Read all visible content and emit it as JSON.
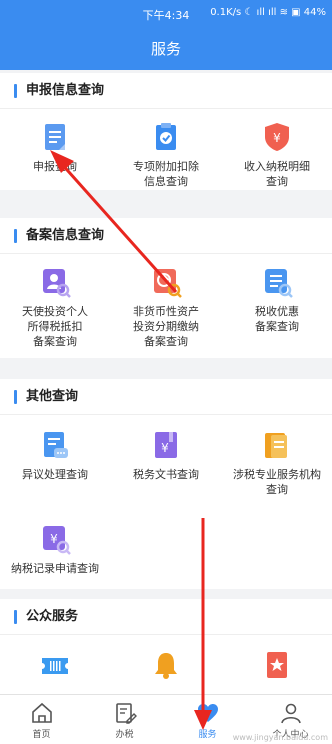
{
  "status_bar": {
    "time": "下午4:34",
    "indicators": "0.1K/s ☾ ıll ıll ≋ ▣ 44%"
  },
  "header": {
    "title": "服务"
  },
  "sections": [
    {
      "title": "申报信息查询",
      "items": [
        {
          "label": "申报查询",
          "icon": "document-icon",
          "color": "#5b9af0"
        },
        {
          "label": "专项附加扣除\n信息查询",
          "icon": "check-clipboard-icon",
          "color": "#3a8cf0"
        },
        {
          "label": "收入纳税明细\n查询",
          "icon": "yuan-shield-icon",
          "color": "#f06050"
        }
      ]
    },
    {
      "title": "备案信息查询",
      "items": [
        {
          "label": "天使投资个人\n所得税抵扣\n备案查询",
          "icon": "person-search-icon",
          "color": "#8a6ae6"
        },
        {
          "label": "非货币性资产\n投资分期缴纳\n备案查询",
          "icon": "chart-search-icon",
          "color": "#f06a5a"
        },
        {
          "label": "税收优惠\n备案查询",
          "icon": "list-search-icon",
          "color": "#4a96f0"
        }
      ]
    },
    {
      "title": "其他查询",
      "items": [
        {
          "label": "异议处理查询",
          "icon": "chat-doc-icon",
          "color": "#4a96f0"
        },
        {
          "label": "税务文书查询",
          "icon": "yuan-doc-icon",
          "color": "#8a6ae6"
        },
        {
          "label": "涉税专业服务机构\n查询",
          "icon": "folder-search-icon",
          "color": "#f0a020"
        },
        {
          "label": "纳税记录申请查询",
          "icon": "yuan-search-icon",
          "color": "#8a6ae6"
        }
      ]
    },
    {
      "title": "公众服务",
      "items": [
        {
          "label": "",
          "icon": "ticket-icon",
          "color": "#3a9af0"
        },
        {
          "label": "",
          "icon": "bell-icon",
          "color": "#f0a020"
        },
        {
          "label": "",
          "icon": "star-doc-icon",
          "color": "#f06050"
        }
      ]
    }
  ],
  "tabbar": [
    {
      "label": "首页",
      "icon": "home-icon",
      "active": false
    },
    {
      "label": "办税",
      "icon": "edit-icon",
      "active": false
    },
    {
      "label": "服务",
      "icon": "heart-icon",
      "active": true
    },
    {
      "label": "个人中心",
      "icon": "user-icon",
      "active": false
    }
  ],
  "watermark": "www.jingyan.baidu.com"
}
